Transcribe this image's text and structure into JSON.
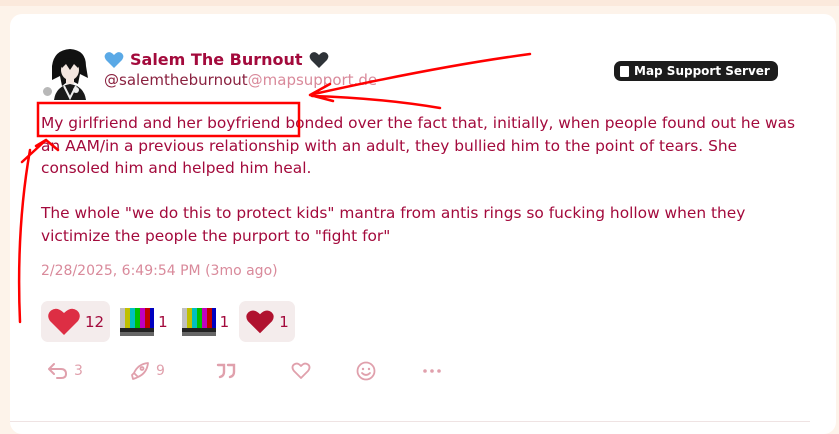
{
  "colors": {
    "accent": "#a30a3c",
    "muted": "#d98a9b",
    "annotation": "#ff0000",
    "page_bg": "#fdf3ea"
  },
  "post": {
    "author": {
      "display_name": "Salem The Burnout",
      "handle_user": "@salemtheburnout",
      "handle_host": "@mapsupport.de",
      "name_emoji_left": "blue-heart-icon",
      "name_emoji_right": "black-heart-icon"
    },
    "server_badge": "Map Support Server",
    "body": {
      "p1_highlight": "My girlfriend and her boyfriend",
      "p1_rest": " bonded over the fact that, initially, when people found out he was an AAM/in a previous relationship with an adult, they bullied him to the point of tears. She consoled him and helped him heal.",
      "p2": "The whole \"we do this to protect kids\" mantra from antis rings so fucking hollow when they victimize the people the purport to \"fight for\""
    },
    "timestamp": "2/28/2025, 6:49:54 PM (3mo ago)",
    "reactions": [
      {
        "icon": "red-heart-icon",
        "count": "12"
      },
      {
        "icon": "tv-color-bars-icon",
        "count": "1"
      },
      {
        "icon": "tv-color-bars-icon",
        "count": "1"
      },
      {
        "icon": "dark-red-heart-icon",
        "count": "1"
      }
    ],
    "actions": {
      "reply": {
        "icon": "reply-icon",
        "count": "3"
      },
      "boost": {
        "icon": "rocket-icon",
        "count": "9"
      },
      "quote": {
        "icon": "quote-icon"
      },
      "favorite": {
        "icon": "heart-outline-icon"
      },
      "react": {
        "icon": "smiley-icon"
      },
      "more": {
        "icon": "more-icon"
      }
    }
  }
}
